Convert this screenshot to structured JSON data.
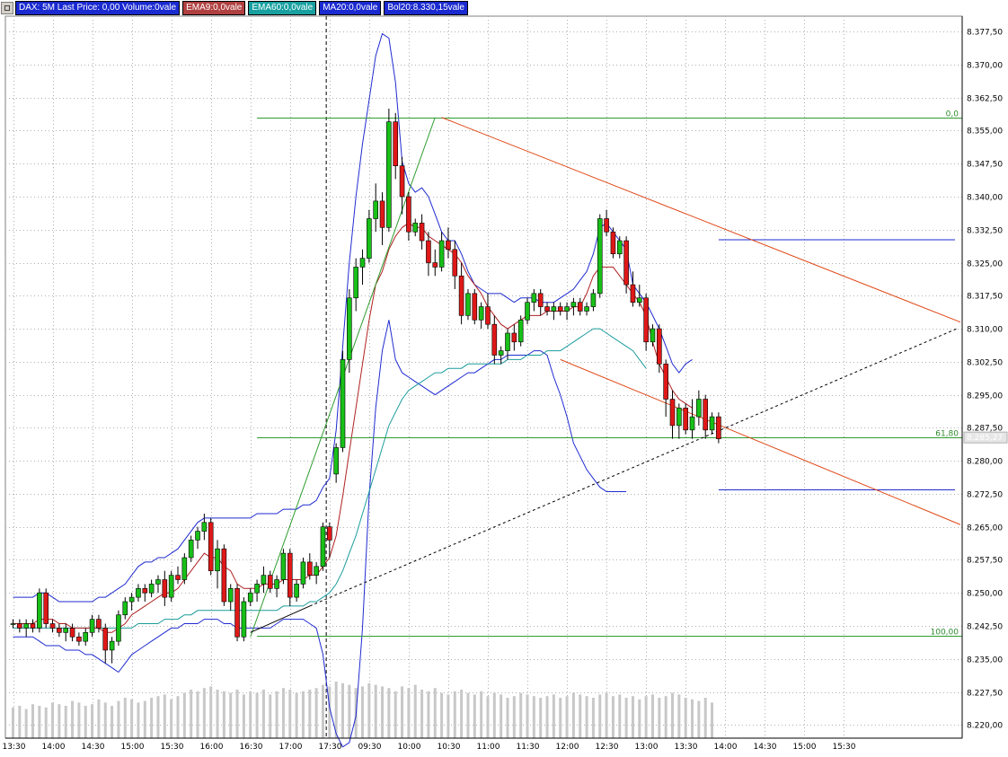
{
  "legend": {
    "title": "DAX: 5M Last Price: 0,00 Volume:0vale",
    "ema9": "EMA9:0,0vale",
    "ema60": "EMA60:0,0vale",
    "ma20": "MA20:0,0vale",
    "bol": "Bol20:8.330,15vale"
  },
  "colors": {
    "background": "#ffffff",
    "grid": "#b0b0b0",
    "candle_up": "#18c018",
    "candle_down": "#e01818",
    "bollinger": "#1f2bd0",
    "ema9": "#b02020",
    "ema60": "#1c9c9c",
    "fib": "#2e9c2e",
    "channel": "#e04818",
    "volume": "#c8c8c8",
    "legend_title_bg": "#1a2ad0",
    "legend_ema9_bg": "#b04040",
    "legend_ema60_bg": "#18a0a0",
    "legend_ma20_bg": "#1a2ad0",
    "legend_bol_bg": "#1a2ad0"
  },
  "price_label": "8.285,27",
  "chart_data": {
    "type": "candlestick",
    "title": "DAX: 5M",
    "y_ticks": [
      "8.377,50",
      "8.370,00",
      "8.362,50",
      "8.355,00",
      "8.347,50",
      "8.340,00",
      "8.332,50",
      "8.325,00",
      "8.317,50",
      "8.310,00",
      "8.302,50",
      "8.295,00",
      "8.287,50",
      "8.280,00",
      "8.272,50",
      "8.265,00",
      "8.257,50",
      "8.250,00",
      "8.242,50",
      "8.235,00",
      "8.227,50",
      "8.220,00"
    ],
    "y_tick_values": [
      8377.5,
      8370,
      8362.5,
      8355,
      8347.5,
      8340,
      8332.5,
      8325,
      8317.5,
      8310,
      8302.5,
      8295,
      8287.5,
      8280,
      8272.5,
      8265,
      8257.5,
      8250,
      8242.5,
      8235,
      8227.5,
      8220
    ],
    "x_ticks": [
      "13:30",
      "14:00",
      "14:30",
      "15:00",
      "15:30",
      "16:00",
      "16:30",
      "17:00",
      "17:30",
      "09:30",
      "10:00",
      "10:30",
      "11:00",
      "11:30",
      "12:00",
      "12:30",
      "13:00",
      "13:30",
      "14:00",
      "14:30",
      "15:00",
      "15:30"
    ],
    "x_tick_index": [
      0,
      6,
      12,
      18,
      24,
      30,
      36,
      42,
      48,
      54,
      60,
      66,
      72,
      78,
      84,
      90,
      96,
      102,
      108,
      114,
      120,
      126
    ],
    "session_break_index": 47.5,
    "ohlc": [
      [
        8243,
        8244,
        8242,
        8243
      ],
      [
        8243,
        8244,
        8241,
        8242
      ],
      [
        8242,
        8244,
        8240,
        8243
      ],
      [
        8243,
        8244,
        8241,
        8242
      ],
      [
        8242,
        8251,
        8241,
        8250
      ],
      [
        8250,
        8251,
        8242,
        8243
      ],
      [
        8243,
        8244,
        8241,
        8242
      ],
      [
        8242,
        8243,
        8240,
        8241
      ],
      [
        8241,
        8243,
        8239,
        8242
      ],
      [
        8242,
        8243,
        8239,
        8240
      ],
      [
        8240,
        8241,
        8238,
        8239
      ],
      [
        8239,
        8242,
        8238,
        8241
      ],
      [
        8241,
        8245,
        8240,
        8244
      ],
      [
        8244,
        8245,
        8241,
        8242
      ],
      [
        8242,
        8243,
        8234,
        8237
      ],
      [
        8237,
        8240,
        8234,
        8239
      ],
      [
        8239,
        8246,
        8238,
        8245
      ],
      [
        8245,
        8249,
        8244,
        8248
      ],
      [
        8248,
        8250,
        8246,
        8249
      ],
      [
        8249,
        8252,
        8248,
        8251
      ],
      [
        8251,
        8252,
        8248,
        8250
      ],
      [
        8250,
        8253,
        8249,
        8252
      ],
      [
        8252,
        8254,
        8250,
        8253
      ],
      [
        8253,
        8255,
        8247,
        8249
      ],
      [
        8249,
        8255,
        8248,
        8254
      ],
      [
        8254,
        8256,
        8252,
        8253
      ],
      [
        8253,
        8259,
        8252,
        8258
      ],
      [
        8258,
        8263,
        8257,
        8262
      ],
      [
        8262,
        8265,
        8260,
        8264
      ],
      [
        8264,
        8268,
        8262,
        8266
      ],
      [
        8266,
        8267,
        8254,
        8255
      ],
      [
        8255,
        8262,
        8251,
        8260
      ],
      [
        8260,
        8261,
        8247,
        8248
      ],
      [
        8248,
        8252,
        8246,
        8251
      ],
      [
        8251,
        8252,
        8239,
        8240
      ],
      [
        8240,
        8249,
        8239,
        8248
      ],
      [
        8248,
        8251,
        8247,
        8250
      ],
      [
        8250,
        8253,
        8248,
        8252
      ],
      [
        8252,
        8256,
        8250,
        8254
      ],
      [
        8254,
        8255,
        8250,
        8251
      ],
      [
        8251,
        8254,
        8249,
        8253
      ],
      [
        8253,
        8260,
        8252,
        8259
      ],
      [
        8259,
        8260,
        8247,
        8249
      ],
      [
        8249,
        8253,
        8248,
        8252
      ],
      [
        8252,
        8258,
        8251,
        8257
      ],
      [
        8257,
        8259,
        8253,
        8254
      ],
      [
        8254,
        8257,
        8252,
        8256
      ],
      [
        8256,
        8266,
        8255,
        8265
      ],
      [
        8265,
        8266,
        8258,
        8262
      ],
      [
        8277,
        8284,
        8275,
        8283
      ],
      [
        8283,
        8305,
        8282,
        8303
      ],
      [
        8303,
        8319,
        8300,
        8317
      ],
      [
        8317,
        8326,
        8314,
        8324
      ],
      [
        8324,
        8328,
        8320,
        8326
      ],
      [
        8326,
        8337,
        8325,
        8335
      ],
      [
        8335,
        8343,
        8332,
        8339
      ],
      [
        8339,
        8341,
        8329,
        8333
      ],
      [
        8333,
        8360,
        8332,
        8357
      ],
      [
        8357,
        8359,
        8344,
        8347
      ],
      [
        8347,
        8349,
        8336,
        8340
      ],
      [
        8340,
        8341,
        8330,
        8332
      ],
      [
        8332,
        8335,
        8331,
        8334
      ],
      [
        8334,
        8336,
        8328,
        8330
      ],
      [
        8330,
        8332,
        8322,
        8325
      ],
      [
        8325,
        8328,
        8322,
        8324
      ],
      [
        8324,
        8332,
        8323,
        8330
      ],
      [
        8330,
        8333,
        8326,
        8328
      ],
      [
        8328,
        8330,
        8319,
        8322
      ],
      [
        8322,
        8325,
        8311,
        8313
      ],
      [
        8313,
        8319,
        8312,
        8318
      ],
      [
        8318,
        8319,
        8311,
        8312
      ],
      [
        8312,
        8316,
        8310,
        8315
      ],
      [
        8315,
        8318,
        8310,
        8311
      ],
      [
        8311,
        8313,
        8302,
        8304
      ],
      [
        8304,
        8306,
        8302,
        8305
      ],
      [
        8305,
        8310,
        8303,
        8309
      ],
      [
        8309,
        8311,
        8305,
        8307
      ],
      [
        8307,
        8313,
        8306,
        8312
      ],
      [
        8312,
        8317,
        8311,
        8316
      ],
      [
        8316,
        8319,
        8314,
        8318
      ],
      [
        8318,
        8319,
        8313,
        8315
      ],
      [
        8315,
        8316,
        8313,
        8314
      ],
      [
        8314,
        8316,
        8312,
        8315
      ],
      [
        8315,
        8316,
        8313,
        8314
      ],
      [
        8314,
        8316,
        8312,
        8315
      ],
      [
        8315,
        8317,
        8313,
        8316
      ],
      [
        8316,
        8317,
        8313,
        8314
      ],
      [
        8314,
        8316,
        8313,
        8315
      ],
      [
        8315,
        8319,
        8314,
        8318
      ],
      [
        8318,
        8336,
        8317,
        8335
      ],
      [
        8335,
        8337,
        8331,
        8332
      ],
      [
        8332,
        8333,
        8326,
        8327
      ],
      [
        8327,
        8331,
        8326,
        8330
      ],
      [
        8330,
        8331,
        8318,
        8320
      ],
      [
        8320,
        8323,
        8315,
        8316
      ],
      [
        8316,
        8320,
        8315,
        8317
      ],
      [
        8317,
        8318,
        8305,
        8307
      ],
      [
        8307,
        8311,
        8306,
        8310
      ],
      [
        8310,
        8311,
        8300,
        8302
      ],
      [
        8302,
        8303,
        8290,
        8294
      ],
      [
        8294,
        8296,
        8285,
        8288
      ],
      [
        8288,
        8293,
        8285,
        8292
      ],
      [
        8292,
        8293,
        8286,
        8287
      ],
      [
        8287,
        8294,
        8285,
        8290
      ],
      [
        8290,
        8296,
        8288,
        8294
      ],
      [
        8294,
        8295,
        8285,
        8287
      ],
      [
        8287,
        8291,
        8286,
        8290
      ],
      [
        8290,
        8291,
        8284,
        8285
      ]
    ],
    "bollinger_upper": [
      8249,
      8249,
      8249,
      8249,
      8250,
      8250,
      8249,
      8248,
      8248,
      8248,
      8248,
      8248,
      8248,
      8249,
      8249,
      8250,
      8251,
      8252,
      8254,
      8256,
      8257,
      8257,
      8258,
      8258,
      8259,
      8260,
      8262,
      8264,
      8266,
      8267,
      8267,
      8267,
      8267,
      8267,
      8267,
      8267,
      8267,
      8268,
      8268,
      8268,
      8268,
      8269,
      8269,
      8269,
      8270,
      8270,
      8271,
      8274,
      8276,
      8287,
      8306,
      8325,
      8340,
      8352,
      8362,
      8372,
      8377,
      8376,
      8366,
      8348,
      8343,
      8341,
      8342,
      8340,
      8336,
      8332,
      8330,
      8330,
      8327,
      8323,
      8320,
      8319,
      8318,
      8318,
      8318,
      8317,
      8316,
      8317,
      8317,
      8317,
      8316,
      8316,
      8316,
      8317,
      8318,
      8319,
      8321,
      8323,
      8327,
      8333,
      8334,
      8332,
      8330,
      8328,
      8320,
      8318,
      8316,
      8313,
      8310,
      8306,
      8302,
      8300,
      8302,
      8303
    ],
    "bollinger_lower": [
      8240,
      8240,
      8240,
      8240,
      8239,
      8238,
      8238,
      8238,
      8237,
      8237,
      8237,
      8236,
      8236,
      8235,
      8234,
      8233,
      8232,
      8234,
      8236,
      8237,
      8238,
      8239,
      8240,
      8241,
      8242,
      8242,
      8243,
      8243,
      8243,
      8244,
      8244,
      8244,
      8243,
      8243,
      8242,
      8242,
      8242,
      8242,
      8242,
      8242,
      8243,
      8244,
      8244,
      8244,
      8244,
      8243,
      8242,
      8236,
      8224,
      8218,
      8215,
      8216,
      8222,
      8242,
      8272,
      8292,
      8305,
      8312,
      8303,
      8300,
      8299,
      8298,
      8297,
      8296,
      8295,
      8296,
      8297,
      8298,
      8299,
      8300,
      8300,
      8301,
      8302,
      8303,
      8303,
      8304,
      8304,
      8304,
      8304,
      8305,
      8305,
      8304,
      8299,
      8295,
      8290,
      8284,
      8281,
      8278,
      8276,
      8274,
      8273,
      8273,
      8273,
      8273
    ],
    "ema9": [
      8243,
      8243,
      8243,
      8243,
      8244,
      8244,
      8244,
      8243,
      8243,
      8242,
      8242,
      8242,
      8242,
      8242,
      8241,
      8241,
      8242,
      8243,
      8245,
      8246,
      8247,
      8248,
      8249,
      8250,
      8250,
      8251,
      8253,
      8255,
      8257,
      8259,
      8258,
      8258,
      8256,
      8255,
      8252,
      8251,
      8251,
      8251,
      8252,
      8252,
      8252,
      8253,
      8253,
      8253,
      8253,
      8254,
      8254,
      8256,
      8258,
      8263,
      8272,
      8282,
      8292,
      8302,
      8312,
      8320,
      8323,
      8328,
      8331,
      8333,
      8334,
      8333,
      8333,
      8331,
      8330,
      8329,
      8328,
      8327,
      8325,
      8322,
      8320,
      8318,
      8315,
      8313,
      8311,
      8310,
      8311,
      8312,
      8313,
      8313,
      8313,
      8314,
      8314,
      8314,
      8314,
      8315,
      8315,
      8318,
      8322,
      8324,
      8324,
      8324,
      8322,
      8320,
      8318,
      8316,
      8313,
      8307,
      8302,
      8299,
      8296,
      8294,
      8293,
      8292
    ],
    "ema60": [
      8242,
      8242,
      8242,
      8242,
      8242,
      8242,
      8242,
      8242,
      8242,
      8242,
      8242,
      8242,
      8242,
      8242,
      8242,
      8242,
      8242,
      8242,
      8242,
      8243,
      8243,
      8243,
      8243,
      8244,
      8244,
      8244,
      8245,
      8245,
      8246,
      8246,
      8246,
      8246,
      8246,
      8246,
      8246,
      8246,
      8246,
      8246,
      8246,
      8246,
      8246,
      8247,
      8247,
      8247,
      8247,
      8248,
      8248,
      8249,
      8250,
      8252,
      8255,
      8259,
      8263,
      8268,
      8273,
      8278,
      8283,
      8288,
      8291,
      8294,
      8296,
      8297,
      8298,
      8299,
      8300,
      8300,
      8301,
      8301,
      8301,
      8302,
      8302,
      8302,
      8302,
      8302,
      8302,
      8303,
      8303,
      8303,
      8304,
      8304,
      8304,
      8305,
      8305,
      8305,
      8306,
      8307,
      8308,
      8309,
      8310,
      8310,
      8309,
      8308,
      8307,
      8306,
      8305,
      8303,
      8301
    ],
    "volume": [
      38,
      40,
      36,
      42,
      40,
      38,
      44,
      42,
      40,
      46,
      44,
      40,
      42,
      48,
      44,
      40,
      46,
      50,
      48,
      44,
      46,
      50,
      52,
      54,
      48,
      52,
      56,
      60,
      58,
      62,
      64,
      60,
      58,
      56,
      60,
      54,
      58,
      56,
      60,
      54,
      58,
      62,
      60,
      56,
      58,
      60,
      62,
      66,
      64,
      70,
      68,
      66,
      62,
      64,
      68,
      66,
      64,
      62,
      58,
      64,
      62,
      66,
      60,
      58,
      62,
      56,
      54,
      58,
      60,
      56,
      54,
      58,
      52,
      56,
      54,
      50,
      52,
      56,
      54,
      52,
      50,
      52,
      54,
      50,
      52,
      56,
      54,
      52,
      50,
      54,
      56,
      52,
      54,
      50,
      52,
      48,
      52,
      54,
      50,
      52,
      56,
      54,
      50,
      48,
      46,
      50,
      44
    ],
    "fib_levels": [
      {
        "label": "0,0",
        "value": 8358
      },
      {
        "label": "61,80",
        "value": 8285.3
      },
      {
        "label": "100,00",
        "value": 8240.3
      }
    ],
    "ylim": [
      8217,
      8381
    ]
  }
}
